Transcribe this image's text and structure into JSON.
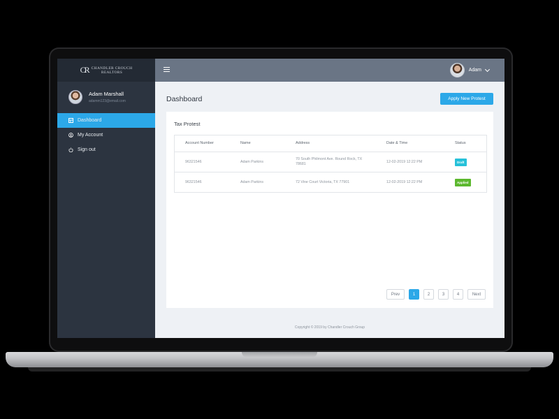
{
  "brand": {
    "monogram": "CR",
    "line1": "CHANDLER CROUCH",
    "line2": "REALTORS"
  },
  "profile": {
    "name": "Adam Marshall",
    "email": "adamm123@email.com"
  },
  "sidebar": {
    "items": [
      {
        "label": "Dashboard",
        "icon": "dashboard-icon",
        "active": true
      },
      {
        "label": "My Account",
        "icon": "user-circle-icon",
        "active": false
      },
      {
        "label": "Sign out",
        "icon": "power-icon",
        "active": false
      }
    ]
  },
  "topbar": {
    "menu_icon": "hamburger-icon",
    "user_name": "Adam"
  },
  "main": {
    "title": "Dashboard",
    "apply_button": "Apply New Protest",
    "card_title": "Tax Protest"
  },
  "table": {
    "headers": [
      "Account Number",
      "Name",
      "Address",
      "Date & Time",
      "Status"
    ],
    "rows": [
      {
        "account": "96321546",
        "name": "Adam Parkins",
        "address": "70 South Philmont Ave. Round Rock, TX 78681",
        "datetime": "12-02-2019 12:22 PM",
        "status": "Draft"
      },
      {
        "account": "96321546",
        "name": "Adam Parkins",
        "address": "72 Vine Court Victoria, TX 77901",
        "datetime": "12-02-2019 12:22 PM",
        "status": "Applied"
      }
    ]
  },
  "pagination": {
    "prev": "Prev",
    "pages": [
      "1",
      "2",
      "3",
      "4"
    ],
    "current": "1",
    "next": "Next"
  },
  "footer": "Copyright © 2019 by Chandler Crouch Group",
  "colors": {
    "accent": "#2ca8e8",
    "draft": "#26c1d9",
    "applied": "#5cb82e",
    "sidebar": "#2c3440",
    "topbar": "#6a7585"
  }
}
